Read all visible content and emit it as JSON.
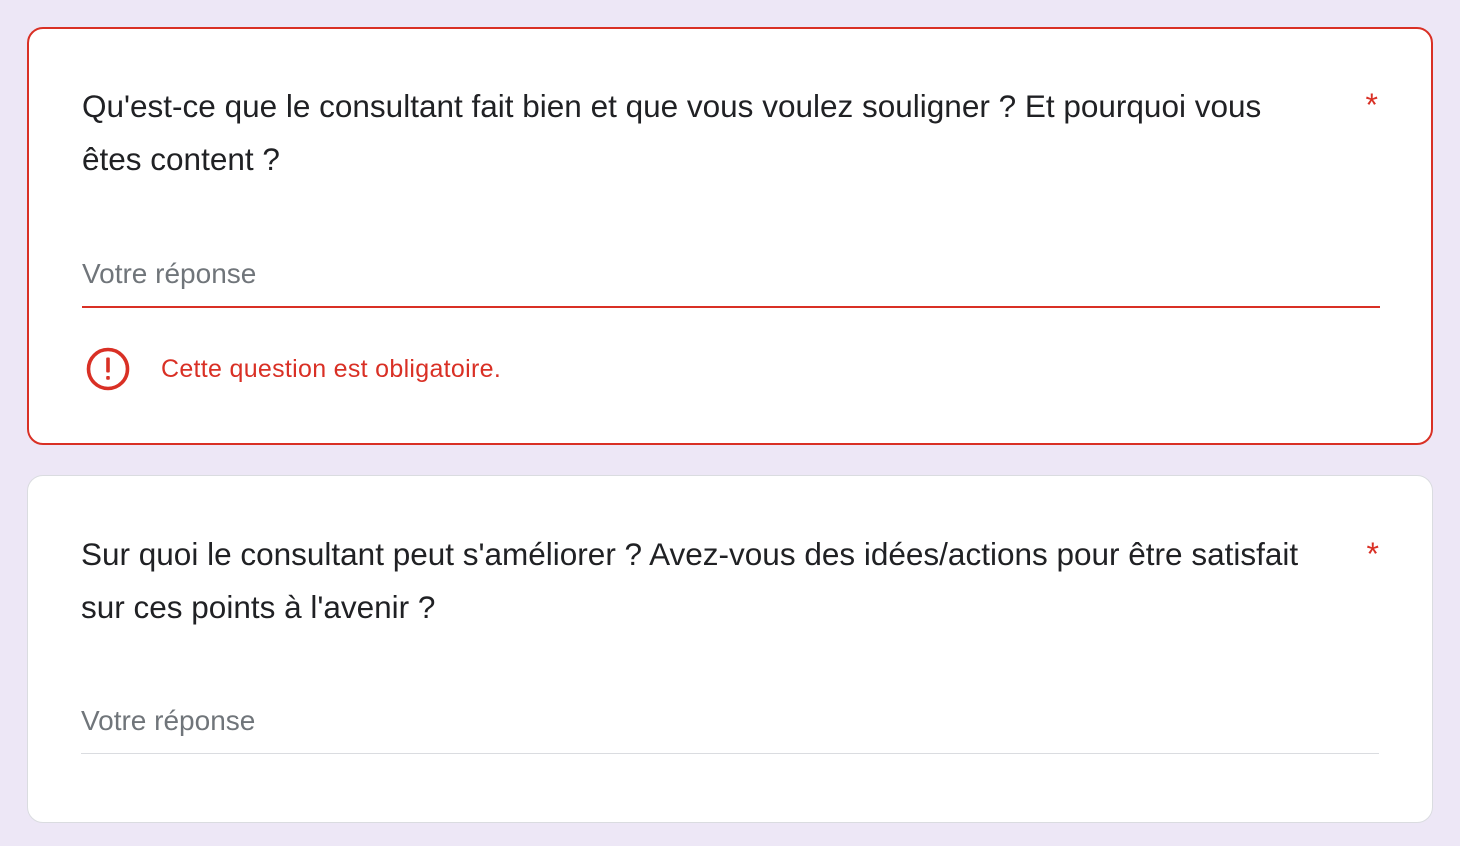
{
  "questions": [
    {
      "text": "Qu'est-ce que le consultant fait bien et que vous voulez souligner ? Et pourquoi vous êtes content ?",
      "required_marker": "*",
      "answer_placeholder": "Votre réponse",
      "answer_value": "",
      "error_message": "Cette question est obligatoire.",
      "error_icon": "error-circle-icon"
    },
    {
      "text": "Sur quoi le consultant peut s'améliorer ? Avez-vous des idées/actions pour être satisfait sur ces points à l'avenir ?",
      "required_marker": "*",
      "answer_placeholder": "Votre réponse",
      "answer_value": ""
    }
  ],
  "colors": {
    "background": "#ede7f6",
    "error": "#d93025",
    "text": "#202124",
    "placeholder": "#70757a",
    "divider": "#dadce0"
  }
}
